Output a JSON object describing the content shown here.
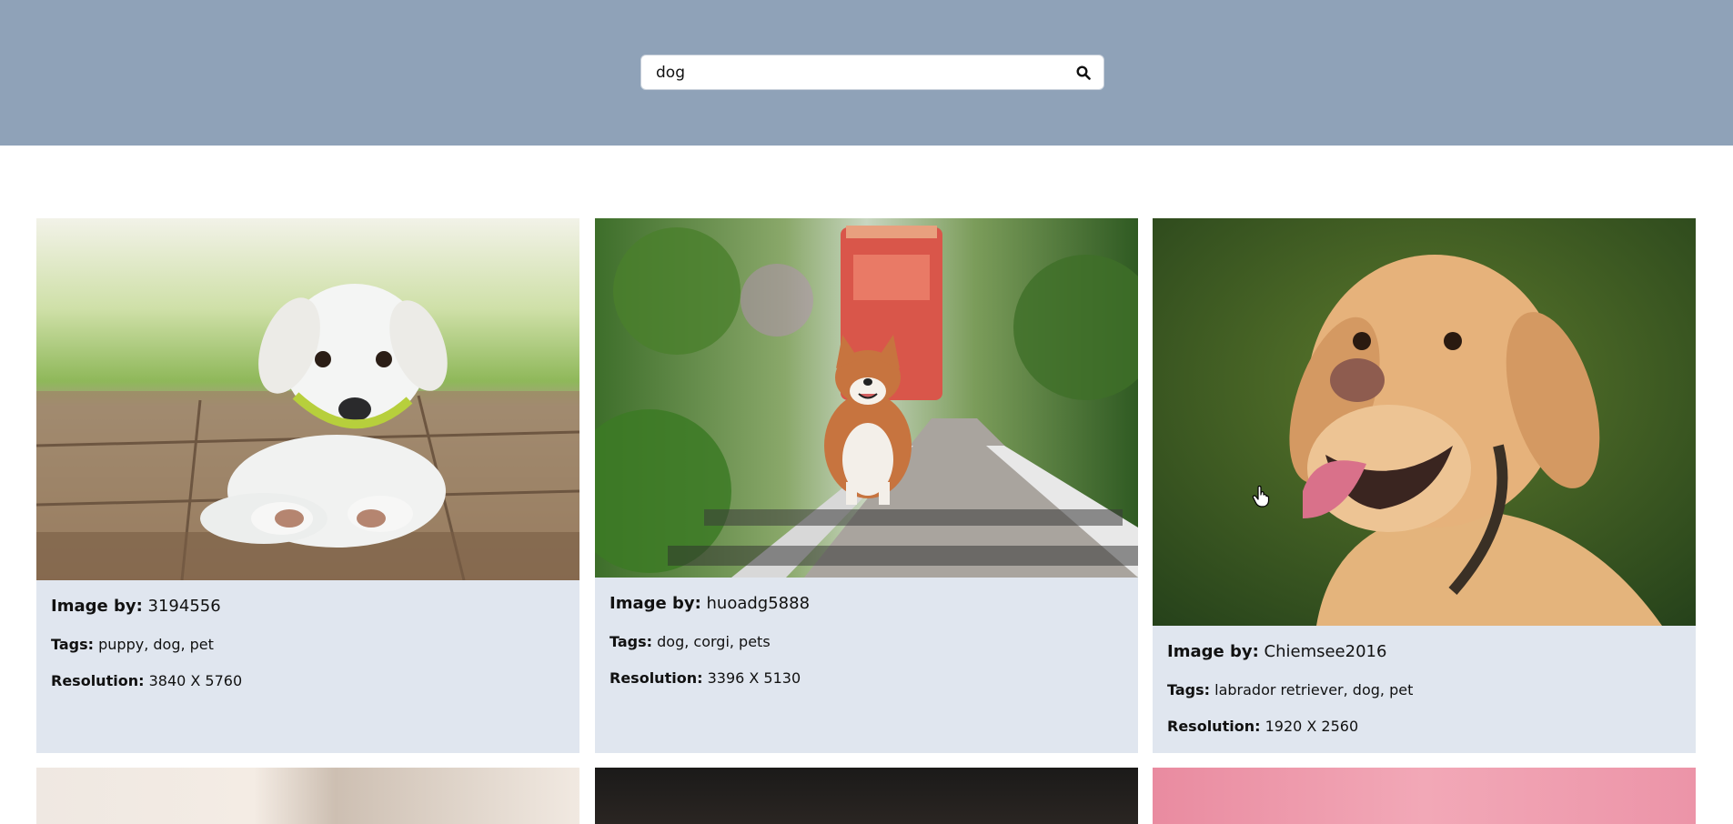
{
  "search": {
    "value": "dog",
    "icon": "search-icon"
  },
  "cards": [
    {
      "image_by_label": "Image by:",
      "author": "3194556",
      "tags_label": "Tags:",
      "tags": "puppy, dog, pet",
      "resolution_label": "Resolution:",
      "resolution": "3840 X 5760"
    },
    {
      "image_by_label": "Image by:",
      "author": "huoadg5888",
      "tags_label": "Tags:",
      "tags": "dog, corgi, pets",
      "resolution_label": "Resolution:",
      "resolution": "3396 X 5130"
    },
    {
      "image_by_label": "Image by:",
      "author": "Chiemsee2016",
      "tags_label": "Tags:",
      "tags": "labrador retriever, dog, pet",
      "resolution_label": "Resolution:",
      "resolution": "1920 X 2560"
    }
  ],
  "colors": {
    "header_bg": "#8fa2b8",
    "card_bg": "#e0e6ef"
  }
}
